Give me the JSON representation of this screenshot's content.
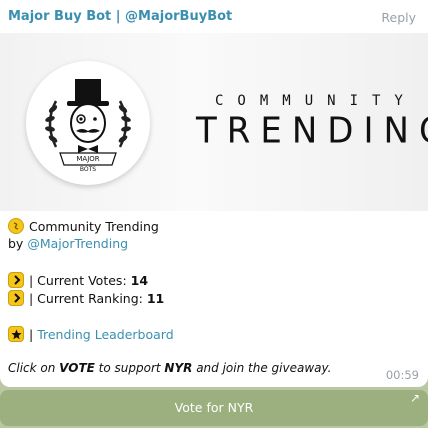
{
  "header": {
    "sender": "Major Buy Bot | @MajorBuyBot",
    "reply_label": "Reply"
  },
  "banner": {
    "logo_text_top": "MAJOR",
    "logo_text_bottom": "BOTS",
    "line1": "COMMUNITY",
    "line2": "TRENDING"
  },
  "message": {
    "title": "Community Trending",
    "by_prefix": "by ",
    "by_link": "@MajorTrending",
    "votes_label": "| Current Votes: ",
    "votes_value": "14",
    "ranking_label": "| Current Ranking: ",
    "ranking_value": "11",
    "leaderboard_sep": "| ",
    "leaderboard_link": "Trending Leaderboard",
    "cta_1": "Click on ",
    "cta_vote": "VOTE",
    "cta_2": " to support ",
    "cta_token": "NYR",
    "cta_3": " and join the giveaway.",
    "time": "00:59"
  },
  "button": {
    "label": "Vote for NYR",
    "arrow": "↗"
  },
  "colors": {
    "link": "#3a8fb0",
    "background": "#b9c7a3",
    "button": "#96aa78",
    "badge": "#f5c518"
  },
  "icons": [
    "coin-icon",
    "arrow-right-icon",
    "star-icon",
    "external-link-icon",
    "bot-logo-icon"
  ]
}
